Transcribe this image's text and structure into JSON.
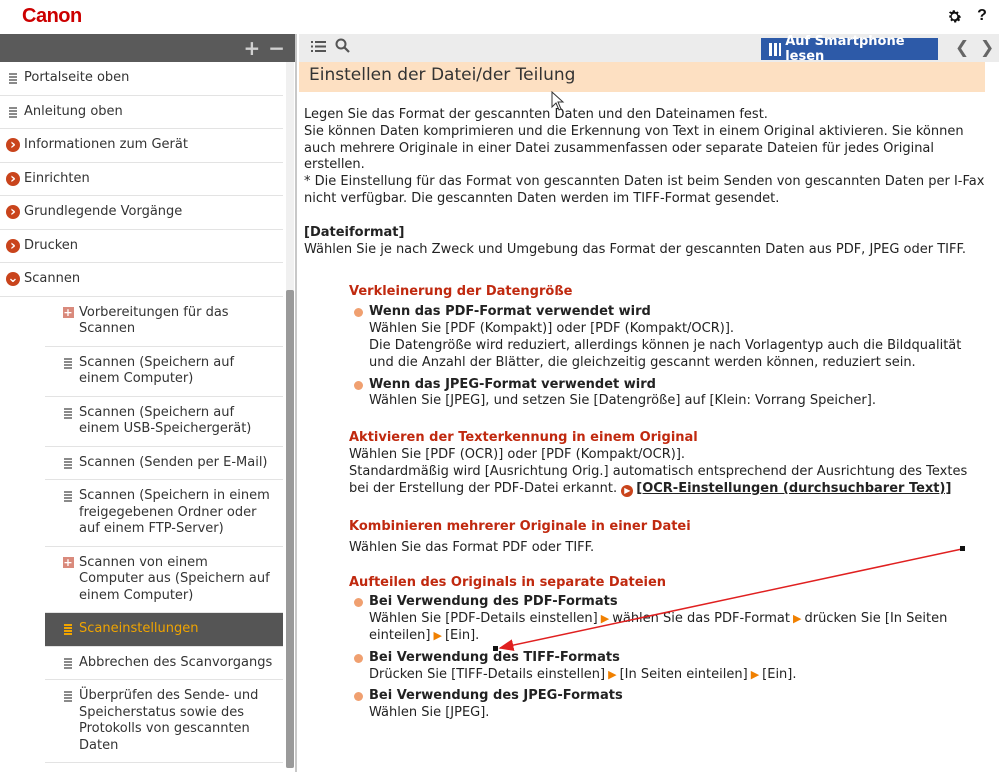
{
  "header": {
    "logo": "Canon",
    "settings_icon": "gear-icon",
    "help_icon": "?"
  },
  "sidebar": {
    "expand_icon": "+",
    "collapse_icon": "−",
    "items": [
      {
        "label": "Portalseite oben",
        "icon": "doc",
        "level": 0
      },
      {
        "label": "Anleitung oben",
        "icon": "doc",
        "level": 0
      },
      {
        "label": "Informationen zum Gerät",
        "icon": "circle-arrow-right",
        "level": 0
      },
      {
        "label": "Einrichten",
        "icon": "circle-arrow-right",
        "level": 0
      },
      {
        "label": "Grundlegende Vorgänge",
        "icon": "circle-arrow-right",
        "level": 0
      },
      {
        "label": "Drucken",
        "icon": "circle-arrow-right",
        "level": 0
      },
      {
        "label": "Scannen",
        "icon": "circle-arrow-down",
        "level": 0
      },
      {
        "label": "Vorbereitungen für das Scannen",
        "icon": "plus",
        "level": 1
      },
      {
        "label": "Scannen (Speichern auf einem Computer)",
        "icon": "doc",
        "level": 1
      },
      {
        "label": "Scannen (Speichern auf einem USB-Speichergerät)",
        "icon": "doc",
        "level": 1
      },
      {
        "label": "Scannen (Senden per E-Mail)",
        "icon": "doc",
        "level": 1
      },
      {
        "label": "Scannen (Speichern in einem freigegebenen Ordner oder auf einem FTP-Server)",
        "icon": "doc",
        "level": 1
      },
      {
        "label": "Scannen von einem Computer aus (Speichern auf einem Computer)",
        "icon": "plus",
        "level": 1
      },
      {
        "label": "Scaneinstellungen",
        "icon": "doc",
        "level": 1,
        "active": true
      },
      {
        "label": "Abbrechen des Scanvorgangs",
        "icon": "doc",
        "level": 1
      },
      {
        "label": "Überprüfen des Sende- und Speicherstatus sowie des Protokolls von gescannten Daten",
        "icon": "doc",
        "level": 1
      }
    ]
  },
  "toolbar": {
    "list_icon": "list-icon",
    "search_icon": "search-icon",
    "smartphone_label": "Auf Smartphone lesen",
    "prev_icon": "chevron-left-icon",
    "next_icon": "chevron-right-icon"
  },
  "content": {
    "title": "Einstellen der Datei/der Teilung",
    "intro_1": "Legen Sie das Format der gescannten Daten und den Dateinamen fest.",
    "intro_2": "Sie können Daten komprimieren und die Erkennung von Text in einem Original aktivieren. Sie können auch mehrere Originale in einer Datei zusammenfassen oder separate Dateien für jedes Original erstellen.",
    "intro_3": "* Die Einstellung für das Format von gescannten Daten ist beim Senden von gescannten Daten per I-Fax nicht verfügbar. Die gescannten Daten werden im TIFF-Format gesendet.",
    "section_label": "[Dateiformat]",
    "section_text": "Wählen Sie je nach Zweck und Umgebung das Format der gescannten Daten aus PDF, JPEG oder TIFF.",
    "h1": "Verkleinerung der Datengröße",
    "h1_b1_title": "Wenn das PDF-Format verwendet wird",
    "h1_b1_text1": "Wählen Sie [PDF (Kompakt)] oder [PDF (Kompakt/OCR)].",
    "h1_b1_text2": "Die Datengröße wird reduziert, allerdings können je nach Vorlagentyp auch die Bildqualität und die Anzahl der Blätter, die gleichzeitig gescannt werden können, reduziert sein.",
    "h1_b2_title": "Wenn das JPEG-Format verwendet wird",
    "h1_b2_text": "Wählen Sie [JPEG], und setzen Sie [Datengröße] auf [Klein: Vorrang Speicher].",
    "h2": "Aktivieren der Texterkennung in einem Original",
    "h2_text1": "Wählen Sie [PDF (OCR)] oder [PDF (Kompakt/OCR)].",
    "h2_text2": "Standardmäßig wird [Ausrichtung Orig.] automatisch entsprechend der Ausrichtung des Textes bei der Erstellung der PDF-Datei erkannt.",
    "h2_link": "[OCR-Einstellungen (durchsuchbarer Text)]",
    "h3": "Kombinieren mehrerer Originale in einer Datei",
    "h3_text": "Wählen Sie das Format PDF oder TIFF.",
    "h4": "Aufteilen des Originals in separate Dateien",
    "h4_b1_title": "Bei Verwendung des PDF-Formats",
    "h4_b1_p1": "Wählen Sie [PDF-Details einstellen]",
    "h4_b1_p2": "wählen Sie das PDF-Format",
    "h4_b1_p3": "drücken Sie [In Seiten einteilen]",
    "h4_b1_p4": "[Ein].",
    "h4_b2_title": "Bei Verwendung des TIFF-Formats",
    "h4_b2_p1": "Drücken Sie [TIFF-Details einstellen]",
    "h4_b2_p2": "[In Seiten einteilen]",
    "h4_b2_p3": "[Ein].",
    "h4_b3_title": "Bei Verwendung des JPEG-Formats",
    "h4_b3_text": "Wählen Sie [JPEG]."
  },
  "colors": {
    "brand_red": "#cc0000",
    "heading_red": "#c0290f",
    "title_bg": "#fde0c2",
    "active_text": "#f0a400",
    "button_blue": "#2d5aa8",
    "annotation_arrow": "#e02020"
  }
}
